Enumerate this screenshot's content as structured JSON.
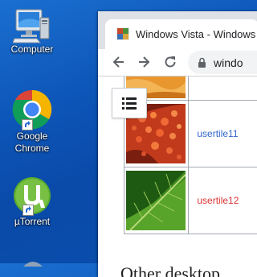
{
  "desktop": {
    "icons": [
      {
        "label": "Computer",
        "icon": "computer-icon"
      },
      {
        "label": "Google Chrome",
        "icon": "chrome-icon",
        "lines": [
          "Google",
          "Chrome"
        ]
      },
      {
        "label": "µTorrent",
        "icon": "utorrent-icon"
      }
    ]
  },
  "browser": {
    "tab_title": "Windows Vista - Windows",
    "address_text": "windo",
    "tiles": [
      {
        "name": "",
        "image": "orange-tile"
      },
      {
        "name": "usertile11",
        "image": "red-starfish-tile",
        "link_state": "visited"
      },
      {
        "name": "usertile12",
        "image": "green-leaf-tile",
        "link_state": "new"
      }
    ],
    "following_text": "Other desktop"
  },
  "colors": {
    "desktop_bg": "#0d55b8",
    "link_blue": "#3366cc",
    "link_red": "#dd3333",
    "tabstrip": "#dee1e6"
  }
}
